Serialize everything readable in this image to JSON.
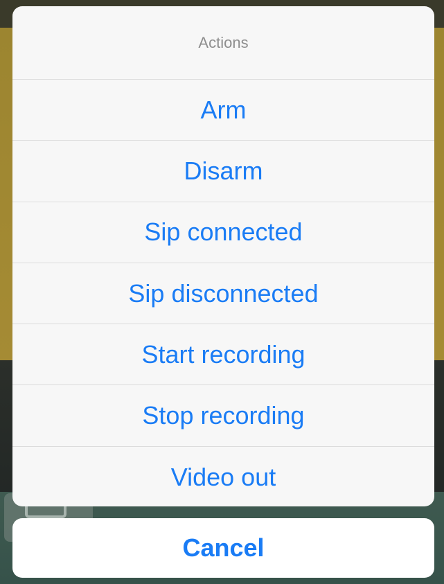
{
  "action_sheet": {
    "title": "Actions",
    "actions": [
      {
        "label": "Arm"
      },
      {
        "label": "Disarm"
      },
      {
        "label": "Sip connected"
      },
      {
        "label": "Sip disconnected"
      },
      {
        "label": "Start recording"
      },
      {
        "label": "Stop recording"
      },
      {
        "label": "Video out"
      }
    ],
    "cancel_label": "Cancel"
  },
  "colors": {
    "accent": "#1a7cf5",
    "sheet_background": "#f7f7f7",
    "title_text": "#8e8e8e",
    "divider": "#dcdcdc"
  }
}
